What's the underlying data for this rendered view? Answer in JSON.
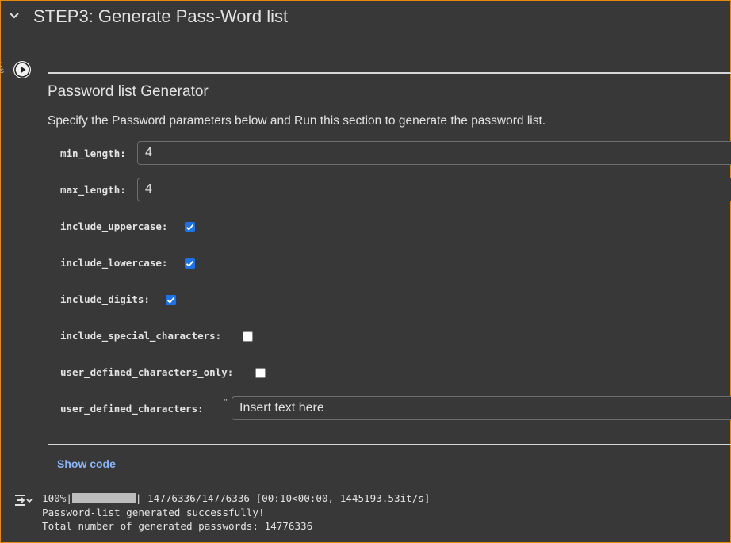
{
  "section": {
    "title": "STEP3: Generate Pass-Word list"
  },
  "form": {
    "title": "Password list Generator",
    "description": "Specify the Password parameters below and Run this section to generate the password list.",
    "min_length": {
      "label": "min_length:",
      "value": "4"
    },
    "max_length": {
      "label": "max_length:",
      "value": "4"
    },
    "include_uppercase": {
      "label": "include_uppercase:",
      "checked": true
    },
    "include_lowercase": {
      "label": "include_lowercase:",
      "checked": true
    },
    "include_digits": {
      "label": "include_digits:",
      "checked": true
    },
    "include_special_characters": {
      "label": "include_special_characters:",
      "checked": false
    },
    "user_defined_characters_only": {
      "label": "user_defined_characters_only:",
      "checked": false
    },
    "user_defined_characters": {
      "label": "user_defined_characters:",
      "value": "Insert text here"
    },
    "show_code_label": "Show code"
  },
  "output": {
    "progress_percent": "100%|",
    "progress_fraction": 1.0,
    "progress_stats": "| 14776336/14776336 [00:10<00:00, 1445193.53it/s]",
    "line2": "Password-list generated successfully!",
    "line3": "Total number of generated passwords: 14776336"
  },
  "colors": {
    "accent_border": "#e8890c",
    "checkbox_checked": "#1a73e8",
    "link": "#8ab4f8",
    "background": "#383838"
  }
}
